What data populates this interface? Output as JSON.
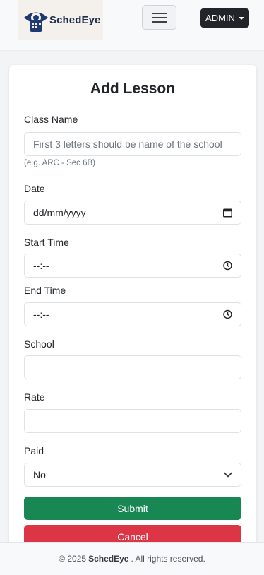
{
  "navbar": {
    "brand_name": "SchedEye",
    "menu_icon": "hamburger-icon",
    "admin_label": "ADMIN"
  },
  "form": {
    "title": "Add Lesson",
    "class_name": {
      "label": "Class Name",
      "placeholder": "First 3 letters should be name of the school",
      "hint": "(e.g. ARC - Sec 6B)"
    },
    "date": {
      "label": "Date",
      "placeholder": "dd/mm/yyyy"
    },
    "start_time": {
      "label": "Start Time",
      "placeholder": "--:--"
    },
    "end_time": {
      "label": "End Time",
      "placeholder": "--:--"
    },
    "school": {
      "label": "School",
      "value": ""
    },
    "rate": {
      "label": "Rate",
      "value": ""
    },
    "paid": {
      "label": "Paid",
      "selected": "No"
    },
    "submit_label": "Submit",
    "cancel_label": "Cancel"
  },
  "footer": {
    "prefix": "© 2025",
    "brand": "SchedEye",
    "suffix": ". All rights reserved."
  },
  "colors": {
    "submit": "#198754",
    "cancel": "#dc3545",
    "admin_button": "#212529"
  }
}
